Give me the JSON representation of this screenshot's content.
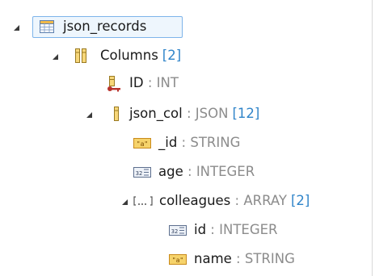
{
  "tree": {
    "rows": [
      {
        "id": "json_records",
        "name": "json_records",
        "sep": "",
        "type": "",
        "count": ""
      },
      {
        "id": "columns",
        "name": "Columns",
        "sep": "",
        "type": "",
        "count": "[2]"
      },
      {
        "id": "id",
        "name": "ID",
        "sep": " : ",
        "type": "INT",
        "count": ""
      },
      {
        "id": "json_col",
        "name": "json_col",
        "sep": " : ",
        "type": "JSON",
        "count": "[12]"
      },
      {
        "id": "_id",
        "name": "_id",
        "sep": " : ",
        "type": "STRING",
        "count": ""
      },
      {
        "id": "age",
        "name": "age",
        "sep": " : ",
        "type": "INTEGER",
        "count": ""
      },
      {
        "id": "colleagues",
        "name": "colleagues",
        "sep": " : ",
        "type": "ARRAY",
        "count": "[2]"
      },
      {
        "id": "colleagues_id",
        "name": "id",
        "sep": " : ",
        "type": "INTEGER",
        "count": ""
      },
      {
        "id": "colleagues_name",
        "name": "name",
        "sep": " : ",
        "type": "STRING",
        "count": ""
      }
    ],
    "icons": {
      "table": "table-icon",
      "columns": "columns-icon",
      "primary_key_column": "primary-key-column-icon",
      "column": "column-icon",
      "string": "string-type-icon",
      "integer": "integer-type-icon",
      "array": "array-type-icon"
    },
    "colors": {
      "count": "#2f84c9",
      "type": "#8c8c8c",
      "selection_border": "#7eb4ea"
    }
  }
}
